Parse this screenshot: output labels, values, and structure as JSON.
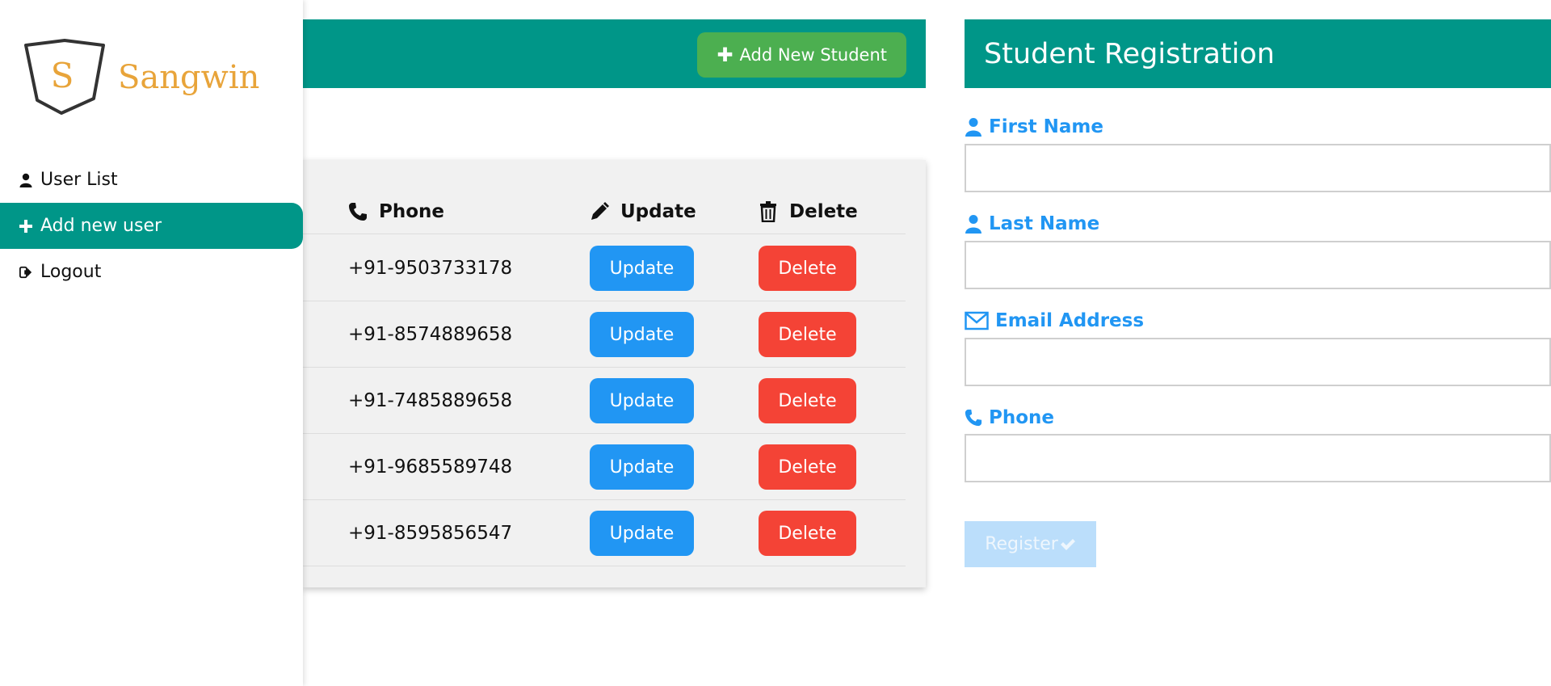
{
  "brand": {
    "logo_letter": "S",
    "name": "Sangwin"
  },
  "sidebar": {
    "items": [
      {
        "label": "User List",
        "icon": "user-icon",
        "active": false
      },
      {
        "label": "Add new user",
        "icon": "plus-icon",
        "active": true
      },
      {
        "label": "Logout",
        "icon": "logout-icon",
        "active": false
      }
    ]
  },
  "topbar": {
    "add_button_label": "Add New Student"
  },
  "table": {
    "columns": [
      {
        "label": "Phone",
        "icon": "phone-icon"
      },
      {
        "label": "Update",
        "icon": "pencil-icon"
      },
      {
        "label": "Delete",
        "icon": "trash-icon"
      }
    ],
    "rows": [
      {
        "phone": "+91-9503733178",
        "update_label": "Update",
        "delete_label": "Delete"
      },
      {
        "phone": "+91-8574889658",
        "update_label": "Update",
        "delete_label": "Delete"
      },
      {
        "phone": "+91-7485889658",
        "update_label": "Update",
        "delete_label": "Delete"
      },
      {
        "phone": "+91-9685589748",
        "update_label": "Update",
        "delete_label": "Delete"
      },
      {
        "phone": "+91-8595856547",
        "update_label": "Update",
        "delete_label": "Delete"
      }
    ]
  },
  "registration": {
    "title": "Student Registration",
    "fields": [
      {
        "label": "First Name",
        "icon": "user-icon",
        "value": ""
      },
      {
        "label": "Last Name",
        "icon": "user-icon",
        "value": ""
      },
      {
        "label": "Email Address",
        "icon": "envelope-icon",
        "value": ""
      },
      {
        "label": "Phone",
        "icon": "phone-icon",
        "value": ""
      }
    ],
    "register_label": "Register",
    "register_icon": "check-icon"
  },
  "colors": {
    "primary_teal": "#009688",
    "success_green": "#4caf50",
    "update_blue": "#2196f3",
    "delete_red": "#f44336",
    "logo_orange": "#e8a43a",
    "register_disabled": "#bbdefb"
  }
}
